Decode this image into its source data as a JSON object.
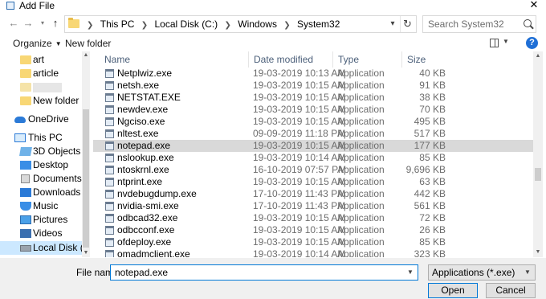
{
  "window": {
    "title": "Add File"
  },
  "address": {
    "breadcrumbs": [
      "This PC",
      "Local Disk (C:)",
      "Windows",
      "System32"
    ]
  },
  "search": {
    "placeholder": "Search System32"
  },
  "toolbar": {
    "organize_label": "Organize",
    "new_folder_label": "New folder",
    "help_label": "?"
  },
  "sidebar": {
    "items": [
      {
        "label": "art",
        "icon": "folder-icon"
      },
      {
        "label": "article",
        "icon": "folder-icon"
      },
      {
        "label": "",
        "icon": "folder-icon"
      },
      {
        "label": "New folder",
        "icon": "folder-icon"
      },
      {
        "label": "OneDrive",
        "icon": "onedrive-icon"
      },
      {
        "label": "This PC",
        "icon": "this-pc-icon"
      },
      {
        "label": "3D Objects",
        "icon": "3d-objects-icon"
      },
      {
        "label": "Desktop",
        "icon": "desktop-icon"
      },
      {
        "label": "Documents",
        "icon": "documents-icon"
      },
      {
        "label": "Downloads",
        "icon": "downloads-icon"
      },
      {
        "label": "Music",
        "icon": "music-icon"
      },
      {
        "label": "Pictures",
        "icon": "pictures-icon"
      },
      {
        "label": "Videos",
        "icon": "videos-icon"
      },
      {
        "label": "Local Disk (C:)",
        "icon": "local-disk-icon"
      }
    ],
    "selected": "Local Disk (C:)"
  },
  "file_list": {
    "columns": [
      "Name",
      "Date modified",
      "Type",
      "Size"
    ],
    "rows": [
      {
        "name": "Netplwiz.exe",
        "date": "19-03-2019 10:13 AM",
        "type": "Application",
        "size": "40 KB"
      },
      {
        "name": "netsh.exe",
        "date": "19-03-2019 10:15 AM",
        "type": "Application",
        "size": "91 KB"
      },
      {
        "name": "NETSTAT.EXE",
        "date": "19-03-2019 10:15 AM",
        "type": "Application",
        "size": "38 KB"
      },
      {
        "name": "newdev.exe",
        "date": "19-03-2019 10:15 AM",
        "type": "Application",
        "size": "70 KB"
      },
      {
        "name": "Ngciso.exe",
        "date": "19-03-2019 10:15 AM",
        "type": "Application",
        "size": "495 KB"
      },
      {
        "name": "nltest.exe",
        "date": "09-09-2019 11:18 PM",
        "type": "Application",
        "size": "517 KB"
      },
      {
        "name": "notepad.exe",
        "date": "19-03-2019 10:15 AM",
        "type": "Application",
        "size": "177 KB"
      },
      {
        "name": "nslookup.exe",
        "date": "19-03-2019 10:14 AM",
        "type": "Application",
        "size": "85 KB"
      },
      {
        "name": "ntoskrnl.exe",
        "date": "16-10-2019 07:57 PM",
        "type": "Application",
        "size": "9,696 KB"
      },
      {
        "name": "ntprint.exe",
        "date": "19-03-2019 10:15 AM",
        "type": "Application",
        "size": "63 KB"
      },
      {
        "name": "nvdebugdump.exe",
        "date": "17-10-2019 11:43 PM",
        "type": "Application",
        "size": "442 KB"
      },
      {
        "name": "nvidia-smi.exe",
        "date": "17-10-2019 11:43 PM",
        "type": "Application",
        "size": "561 KB"
      },
      {
        "name": "odbcad32.exe",
        "date": "19-03-2019 10:15 AM",
        "type": "Application",
        "size": "72 KB"
      },
      {
        "name": "odbcconf.exe",
        "date": "19-03-2019 10:15 AM",
        "type": "Application",
        "size": "26 KB"
      },
      {
        "name": "ofdeploy.exe",
        "date": "19-03-2019 10:15 AM",
        "type": "Application",
        "size": "85 KB"
      },
      {
        "name": "omadmclient.exe",
        "date": "19-03-2019 10:14 AM",
        "type": "Application",
        "size": "323 KB"
      }
    ],
    "selected": "notepad.exe"
  },
  "footer": {
    "filename_label": "File name:",
    "filename_value": "notepad.exe",
    "filter_value": "Applications (*.exe)",
    "open_label": "Open",
    "cancel_label": "Cancel"
  },
  "colors": {
    "accent": "#0078d7",
    "selection": "#cce8ff",
    "row_selected": "#d9d9d9",
    "folder": "#f8d775"
  }
}
